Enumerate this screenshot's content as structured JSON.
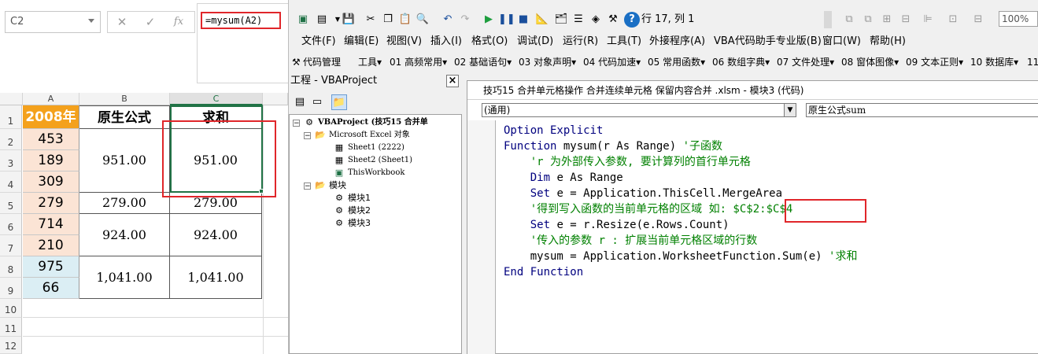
{
  "excel": {
    "name_box": "C2",
    "formula": "=mysum(A2)",
    "columns": [
      "A",
      "B",
      "C"
    ],
    "rows": [
      "1",
      "2",
      "3",
      "4",
      "5",
      "6",
      "7",
      "8",
      "9",
      "10",
      "11",
      "12"
    ],
    "header_a": "2008年",
    "header_b": "原生公式",
    "header_c": "求和",
    "col_a_values": [
      "453",
      "189",
      "309",
      "279",
      "714",
      "210",
      "975",
      "66"
    ],
    "merged_values": [
      {
        "b": "951.00",
        "c": "951.00"
      },
      {
        "b": "279.00",
        "c": "279.00"
      },
      {
        "b": "924.00",
        "c": "924.00"
      },
      {
        "b": "1,041.00",
        "c": "1,041.00"
      }
    ]
  },
  "vbe": {
    "position": "行 17, 列 1",
    "zoom": "100%",
    "menu": [
      "文件(F)",
      "编辑(E)",
      "视图(V)",
      "插入(I)",
      "格式(O)",
      "调试(D)",
      "运行(R)",
      "工具(T)",
      "外接程序(A)",
      "VBA代码助手专业版(B)",
      "窗口(W)",
      "帮助(H)"
    ],
    "addin_bar": [
      "代码管理",
      "工具▾",
      "01 高频常用▾",
      "02 基础语句▾",
      "03 对象声明▾",
      "04 代码加速▾",
      "05 常用函数▾",
      "06 数组字典▾",
      "07 文件处理▾",
      "08 窗体图像▾",
      "09 文本正则▾",
      "10 数据库▾",
      "11"
    ],
    "project_title": "工程 - VBAProject",
    "tree": {
      "root": "VBAProject (技巧15  合并单",
      "excel_objects": "Microsoft Excel 对象",
      "sheet1": "Sheet1 (2222)",
      "sheet2": "Sheet2 (Sheet1)",
      "workbook": "ThisWorkbook",
      "modules": "模块",
      "module1": "模块1",
      "module2": "模块2",
      "module3": "模块3"
    },
    "code_title": "技巧15  合并单元格操作  合并连续单元格  保留内容合并 .xlsm - 模块3 (代码)",
    "combo_left": "(通用)",
    "combo_right": "原生公式sum",
    "code_lines": [
      {
        "indent": "",
        "kw": "Option Explicit",
        "rest": "",
        "comment": ""
      },
      {
        "indent": "",
        "kw": "Function",
        "rest": " mysum(r As Range) ",
        "comment": "'子函数"
      },
      {
        "indent": "    ",
        "kw": "",
        "rest": "",
        "comment": "'r 为外部传入参数, 要计算列的首行单元格"
      },
      {
        "indent": "    ",
        "kw": "Dim",
        "rest": " e As Range",
        "comment": ""
      },
      {
        "indent": "    ",
        "kw": "Set",
        "rest": " e = Application.ThisCell.MergeArea",
        "comment": ""
      },
      {
        "indent": "    ",
        "kw": "",
        "rest": "",
        "comment": "'得到写入函数的当前单元格的区域 如: $C$2:$C$4"
      },
      {
        "indent": "    ",
        "kw": "Set",
        "rest": " e = r.Resize(e.Rows.Count)",
        "comment": ""
      },
      {
        "indent": "    ",
        "kw": "",
        "rest": "",
        "comment": "'传入的参数 r : 扩展当前单元格区域的行数"
      },
      {
        "indent": "    ",
        "kw": "",
        "rest": "mysum = Application.WorksheetFunction.Sum(e) ",
        "comment": "'求和"
      },
      {
        "indent": "",
        "kw": "End Function",
        "rest": "",
        "comment": ""
      }
    ]
  }
}
